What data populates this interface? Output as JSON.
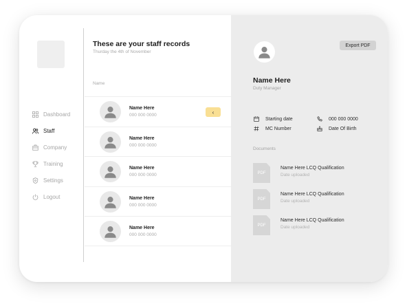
{
  "sidebar": {
    "items": [
      {
        "label": "Dashboard",
        "icon": "dashboard-icon",
        "active": false
      },
      {
        "label": "Staff",
        "icon": "staff-icon",
        "active": true
      },
      {
        "label": "Company",
        "icon": "company-icon",
        "active": false
      },
      {
        "label": "Training",
        "icon": "training-icon",
        "active": false
      },
      {
        "label": "Settings",
        "icon": "settings-icon",
        "active": false
      },
      {
        "label": "Logout",
        "icon": "logout-icon",
        "active": false
      }
    ]
  },
  "main": {
    "title": "These are your staff records",
    "date": "Thurday the 4th of November",
    "column_header": "Name",
    "staff": [
      {
        "name": "Name Here",
        "phone": "000 000 0000"
      },
      {
        "name": "Name Here",
        "phone": "000 000 0000"
      },
      {
        "name": "Name Here",
        "phone": "000 000 0000"
      },
      {
        "name": "Name Here",
        "phone": "000 000 0000"
      },
      {
        "name": "Name Here",
        "phone": "000 000 0000"
      }
    ],
    "selected_chevron": "‹"
  },
  "profile": {
    "export_label": "Export PDF",
    "name": "Name Here",
    "role": "Duty Manager",
    "fields": {
      "starting_date": "Starting date",
      "phone": "000 000 0000",
      "mc_number": "MC Number",
      "date_of_birth": "Date Of Birth"
    },
    "documents_label": "Documents",
    "documents": [
      {
        "type": "PDF",
        "title": "Name Here LCQ Qualification",
        "subtitle": "Date uploaded"
      },
      {
        "type": "PDF",
        "title": "Name Here LCQ Qualification",
        "subtitle": "Date uploaded"
      },
      {
        "type": "PDF",
        "title": "Name Here LCQ Qualification",
        "subtitle": "Date uploaded"
      }
    ]
  },
  "colors": {
    "accent": "#f9df94",
    "panel": "#ececec",
    "export_button": "#d3d3d3"
  }
}
